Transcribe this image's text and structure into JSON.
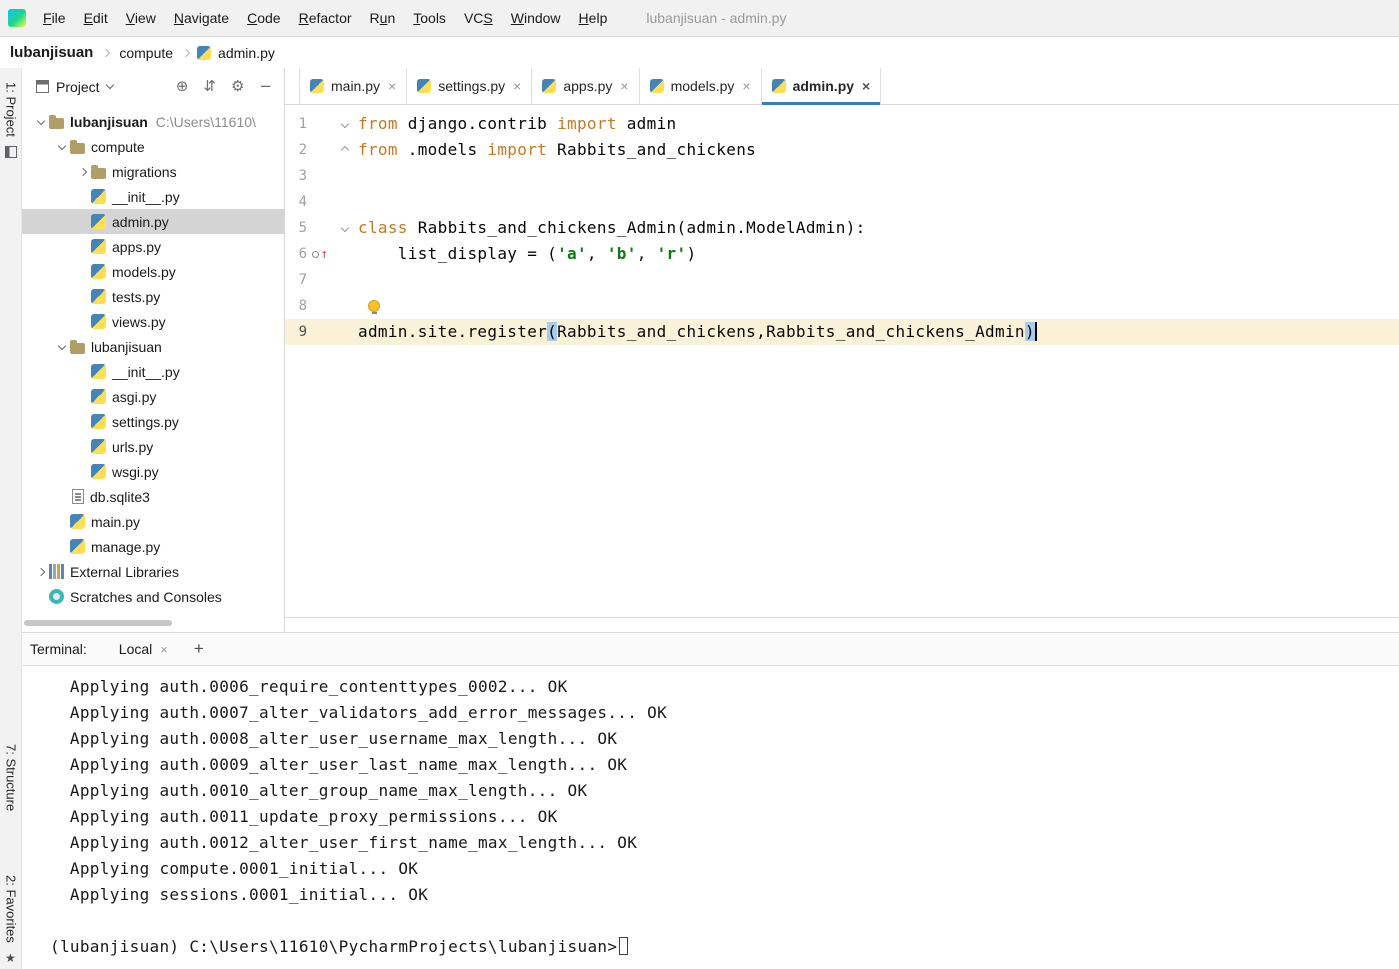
{
  "colors": {
    "accent": "#3e7bbf",
    "keyword": "#c57a22",
    "string": "#0a7a12",
    "current_line": "#faf2d8",
    "paren_match": "#a9cbed",
    "selection": "#d4d4d4"
  },
  "icons": {
    "close": "×",
    "plus": "+"
  },
  "titlebar": {
    "window_title": "lubanjisuan - admin.py",
    "menus": [
      {
        "label": "File",
        "mnemonic_index": 0
      },
      {
        "label": "Edit",
        "mnemonic_index": 0
      },
      {
        "label": "View",
        "mnemonic_index": 0
      },
      {
        "label": "Navigate",
        "mnemonic_index": 0
      },
      {
        "label": "Code",
        "mnemonic_index": 0
      },
      {
        "label": "Refactor",
        "mnemonic_index": 0
      },
      {
        "label": "Run",
        "mnemonic_index": 1
      },
      {
        "label": "Tools",
        "mnemonic_index": 0
      },
      {
        "label": "VCS",
        "mnemonic_index": 2
      },
      {
        "label": "Window",
        "mnemonic_index": 0
      },
      {
        "label": "Help",
        "mnemonic_index": 0
      }
    ]
  },
  "breadcrumbs": {
    "items": [
      "lubanjisuan",
      "compute",
      "admin.py"
    ]
  },
  "tool_strip": {
    "project": "1: Project",
    "structure": "7: Structure",
    "favorites": "2: Favorites",
    "favorites_star": "★"
  },
  "project_panel": {
    "title": "Project",
    "toolbar_icons": [
      {
        "name": "locate",
        "glyph": "⊕"
      },
      {
        "name": "collapse-all",
        "glyph": "⇵"
      },
      {
        "name": "settings",
        "glyph": "⚙"
      },
      {
        "name": "hide",
        "glyph": "−"
      }
    ],
    "tree": [
      {
        "label": "lubanjisuan",
        "suffix": "C:\\Users\\11610\\",
        "icon": "folder",
        "indent": 0,
        "chevron": "down",
        "bold": true
      },
      {
        "label": "compute",
        "icon": "folder",
        "indent": 1,
        "chevron": "down"
      },
      {
        "label": "migrations",
        "icon": "folder",
        "indent": 2,
        "chevron": "right"
      },
      {
        "label": "__init__.py",
        "icon": "python",
        "indent": 2
      },
      {
        "label": "admin.py",
        "icon": "python",
        "indent": 2,
        "selected": true
      },
      {
        "label": "apps.py",
        "icon": "python",
        "indent": 2
      },
      {
        "label": "models.py",
        "icon": "python",
        "indent": 2
      },
      {
        "label": "tests.py",
        "icon": "python",
        "indent": 2
      },
      {
        "label": "views.py",
        "icon": "python",
        "indent": 2
      },
      {
        "label": "lubanjisuan",
        "icon": "folder",
        "indent": 1,
        "chevron": "down"
      },
      {
        "label": "__init__.py",
        "icon": "python",
        "indent": 2
      },
      {
        "label": "asgi.py",
        "icon": "python",
        "indent": 2
      },
      {
        "label": "settings.py",
        "icon": "python",
        "indent": 2
      },
      {
        "label": "urls.py",
        "icon": "python",
        "indent": 2
      },
      {
        "label": "wsgi.py",
        "icon": "python",
        "indent": 2
      },
      {
        "label": "db.sqlite3",
        "icon": "db",
        "indent": 1
      },
      {
        "label": "main.py",
        "icon": "python",
        "indent": 1
      },
      {
        "label": "manage.py",
        "icon": "python",
        "indent": 1
      },
      {
        "label": "External Libraries",
        "icon": "library",
        "indent": 0,
        "chevron": "right"
      },
      {
        "label": "Scratches and Consoles",
        "icon": "scratch",
        "indent": 0
      }
    ]
  },
  "editor": {
    "tabs": [
      {
        "label": "main.py"
      },
      {
        "label": "settings.py"
      },
      {
        "label": "apps.py"
      },
      {
        "label": "models.py"
      },
      {
        "label": "admin.py",
        "active": true
      }
    ],
    "lines": [
      {
        "n": 1,
        "fold": "down",
        "tokens": [
          {
            "t": "from",
            "c": "kw"
          },
          {
            "t": " django.contrib ",
            "c": "plain"
          },
          {
            "t": "import",
            "c": "kw"
          },
          {
            "t": " admin",
            "c": "plain"
          }
        ]
      },
      {
        "n": 2,
        "fold": "up",
        "tokens": [
          {
            "t": "from",
            "c": "kw"
          },
          {
            "t": " .models ",
            "c": "plain"
          },
          {
            "t": "import",
            "c": "kw"
          },
          {
            "t": " Rabbits_and_chickens",
            "c": "plain"
          }
        ]
      },
      {
        "n": 3,
        "tokens": []
      },
      {
        "n": 4,
        "tokens": []
      },
      {
        "n": 5,
        "fold": "down",
        "tokens": [
          {
            "t": "class",
            "c": "kw"
          },
          {
            "t": " Rabbits_and_chickens_Admin(admin.ModelAdmin):",
            "c": "plain"
          }
        ]
      },
      {
        "n": 6,
        "gutter_icon": "override",
        "tokens": [
          {
            "t": "    list_display = (",
            "c": "plain"
          },
          {
            "t": "'a'",
            "c": "str"
          },
          {
            "t": ", ",
            "c": "plain"
          },
          {
            "t": "'b'",
            "c": "str"
          },
          {
            "t": ", ",
            "c": "plain"
          },
          {
            "t": "'r'",
            "c": "str"
          },
          {
            "t": ")",
            "c": "plain"
          }
        ]
      },
      {
        "n": 7,
        "tokens": []
      },
      {
        "n": 8,
        "bulb": true,
        "tokens": []
      },
      {
        "n": 9,
        "current": true,
        "caret": true,
        "tokens": [
          {
            "t": "admin.site.register",
            "c": "plain"
          },
          {
            "t": "(",
            "c": "paren"
          },
          {
            "t": "Rabbits_and_chickens,Rabbits_and_chickens_Admin",
            "c": "plain"
          },
          {
            "t": ")",
            "c": "paren"
          }
        ]
      }
    ]
  },
  "terminal": {
    "label": "Terminal:",
    "tab": "Local",
    "lines": [
      "  Applying auth.0006_require_contenttypes_0002... OK",
      "  Applying auth.0007_alter_validators_add_error_messages... OK",
      "  Applying auth.0008_alter_user_username_max_length... OK",
      "  Applying auth.0009_alter_user_last_name_max_length... OK",
      "  Applying auth.0010_alter_group_name_max_length... OK",
      "  Applying auth.0011_update_proxy_permissions... OK",
      "  Applying auth.0012_alter_user_first_name_max_length... OK",
      "  Applying compute.0001_initial... OK",
      "  Applying sessions.0001_initial... OK",
      "",
      "(lubanjisuan) C:\\Users\\11610\\PycharmProjects\\lubanjisuan>"
    ]
  }
}
